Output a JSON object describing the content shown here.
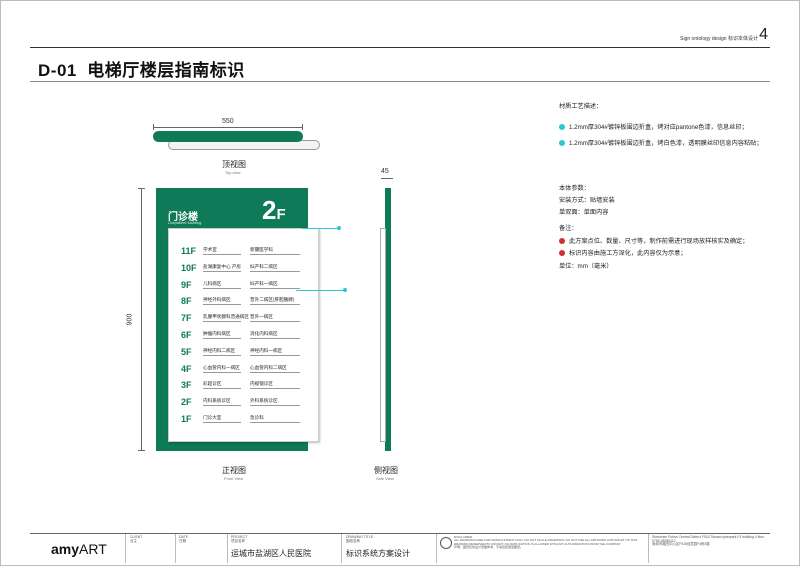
{
  "header": {
    "caption_en": "Sign ontology design",
    "caption_cn": "标识本体设计",
    "sheet_number": "4"
  },
  "title": "D-01  电梯厅楼层指南标识",
  "top_view": {
    "width_label": "550",
    "caption_cn": "顶视图",
    "caption_en": "Top view"
  },
  "front_view": {
    "height_label": "900",
    "building_name": "门诊楼",
    "building_en": "Outpatient building",
    "floor": "2",
    "floor_suffix": "F",
    "caption_cn": "正视图",
    "caption_en": "Front View",
    "floors": [
      {
        "floor": "11F",
        "left": "学术室",
        "right": "新疆医学科"
      },
      {
        "floor": "10F",
        "left": "盐湖康复中心 产房",
        "right": "妇产科二病区"
      },
      {
        "floor": "9F",
        "left": "儿科病区",
        "right": "妇产科一病区"
      },
      {
        "floor": "8F",
        "left": "神经外科病区",
        "right": "普外二病区(肝胆胰脾)"
      },
      {
        "floor": "7F",
        "left": "乳腺甲状腺科普通病区",
        "right": "普外一病区"
      },
      {
        "floor": "6F",
        "left": "肿瘤内科病区",
        "right": "消化内科病区"
      },
      {
        "floor": "5F",
        "left": "神经内科二病区",
        "right": "神经内科一病区"
      },
      {
        "floor": "4F",
        "left": "心血管内科一病区",
        "right": "心血管内科二病区"
      },
      {
        "floor": "3F",
        "left": "彩超诊区",
        "right": "内窥镜诊区"
      },
      {
        "floor": "2F",
        "left": "内科系统诊区",
        "right": "外科系统诊区"
      },
      {
        "floor": "1F",
        "left": "门诊大室",
        "right": "急诊科"
      }
    ]
  },
  "side_view": {
    "depth_label": "45",
    "caption_cn": "侧视图",
    "caption_en": "Side View"
  },
  "notes": {
    "material_title": "材质工艺描述：",
    "material_items": [
      "1.2mm厚304#镀锌板围边折盒，烤对应pantone色漆，信息丝印；",
      "1.2mm厚304#镀锌板围边折盒，烤白色漆，透明膜丝印信息内容粘贴；"
    ],
    "params_title": "本体参数：",
    "install": "安装方式：贴墙安装",
    "surface": "单双面：单面内容",
    "remark_title": "备注：",
    "remark_items": [
      "此方案点位、数量、尺寸等，制作前需进行现场放样核实及确定；",
      "标识内容由施工方深化，此内容仅为示意；"
    ],
    "unit": "单位：mm（毫米）"
  },
  "footer": {
    "logo_a": "amy",
    "logo_b": "ART",
    "client_label": "CLIENT",
    "client_sub": "业主",
    "date_label": "DATE",
    "date_sub": "日期",
    "project_label": "PROJECT",
    "project_sub": "项目名称",
    "project": "运城市盐湖区人民医院",
    "drawing_label": "DRAWING TITLE",
    "drawing_sub": "图纸名称",
    "drawing": "标识系统方案设计",
    "disclaimer_label": "DISCLAIMER",
    "disclaimer": "ALL DRAWINGS ARE FOR DESIGN INTENT ONLY. DO NOT SCALE DRAWINGS. DO NOT USE ALL ARTWORK COPYRIGHT OF THIS DRAWING RESERVED BY AMYART. NO DUPLICATION IS ALLOWED WITHOUT AUTHORIZATION FROM THE COMPANY.",
    "disclaimer_cn": "声明：图纸仅供设计意图参考，不得直接量度图纸。",
    "address": "Shenzhen Futian Central District F518 Tianan cyberpark F4 building 4 floor",
    "phone": "0755-28556112",
    "address_cn": "深圳市福田中心区F518创意园F4栋4楼"
  }
}
